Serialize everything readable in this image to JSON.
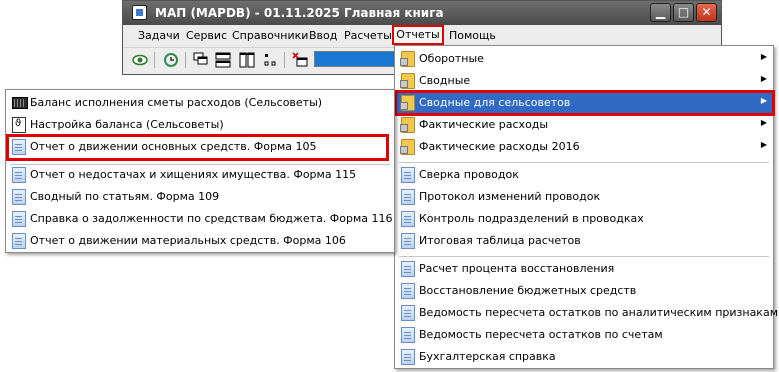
{
  "window": {
    "title": "МАП (MAPDB) - 01.11.2025 Главная книга",
    "menu": [
      "Задачи",
      "Сервис",
      "Справочники",
      "Ввод",
      "Расчеты",
      "Отчеты",
      "Помощь"
    ],
    "toolbar_icons": [
      "view-icon",
      "refresh-icon",
      "cascade-icon",
      "tile-horizontal-icon",
      "tile-vertical-icon",
      "arrange-icon",
      "close-all-icon"
    ],
    "controls": {
      "minimize": "▁",
      "maximize": "□",
      "close": "✕"
    },
    "progress_color": "#1877d2"
  },
  "reports_menu": {
    "items": [
      {
        "label": "Оборотные",
        "icon": "folder-icon",
        "submenu": true
      },
      {
        "label": "Сводные",
        "icon": "folder-icon",
        "submenu": true
      },
      {
        "label": "Сводные для сельсоветов",
        "icon": "folder-icon",
        "submenu": true,
        "highlighted": true
      },
      {
        "label": "Фактические расходы",
        "icon": "folder-icon",
        "submenu": true
      },
      {
        "label": "Фактические расходы 2016",
        "icon": "folder-icon",
        "submenu": true
      },
      {
        "label": "Сверка проводок",
        "icon": "document-icon"
      },
      {
        "label": "Протокол изменений проводок",
        "icon": "document-icon"
      },
      {
        "label": "Контроль подразделений в проводках",
        "icon": "document-icon"
      },
      {
        "label": "Итоговая таблица расчетов",
        "icon": "document-icon"
      },
      {
        "label": "Расчет процента восстановления",
        "icon": "document-icon"
      },
      {
        "label": "Восстановление бюджетных средств",
        "icon": "document-icon"
      },
      {
        "label": "Ведомость пересчета остатков по аналитическим признакам",
        "icon": "document-icon"
      },
      {
        "label": "Ведомость пересчета остатков по счетам",
        "icon": "document-icon"
      },
      {
        "label": "Бухгалтерская справка",
        "icon": "document-icon"
      }
    ],
    "arrow": "▶"
  },
  "village_submenu": {
    "items": [
      {
        "label": "Баланс исполнения сметы расходов (Сельсоветы)",
        "icon": "table-icon"
      },
      {
        "label": "Настройка баланса (Сельсоветы)",
        "icon": "settings-document-icon"
      },
      {
        "label": "Отчет о движении основных средств. Форма 105",
        "icon": "document-icon",
        "outlined": true
      },
      {
        "label": "Отчет о недостачах и хищениях имущества. Форма 115",
        "icon": "document-icon"
      },
      {
        "label": "Сводный по статьям. Форма 109",
        "icon": "document-icon"
      },
      {
        "label": "Справка о задолженности по средствам бюджета. Форма 116",
        "icon": "document-icon"
      },
      {
        "label": "Отчет о движении материальных средств. Форма 106",
        "icon": "document-icon"
      }
    ]
  }
}
